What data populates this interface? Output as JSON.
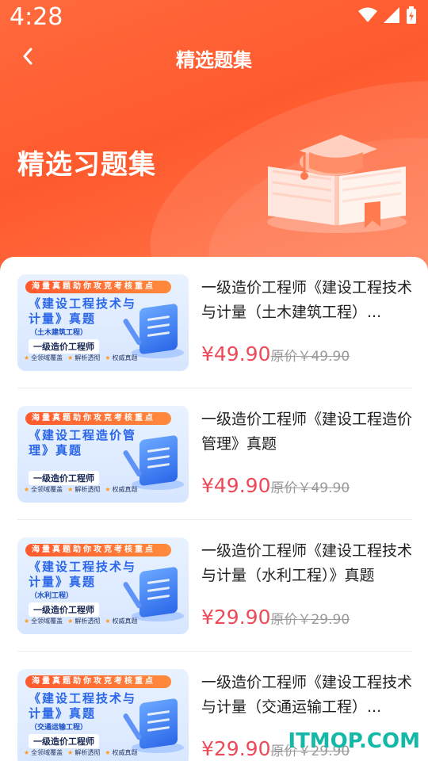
{
  "status_bar": {
    "time": "4:28"
  },
  "nav": {
    "title": "精选题集"
  },
  "hero": {
    "title": "精选习题集"
  },
  "thumb_common": {
    "banner": "海量真题助你攻克考核重点",
    "tag": "一级造价工程师",
    "features": [
      "全领域覆盖",
      "解析透彻",
      "权威真题"
    ]
  },
  "items": [
    {
      "thumb_title": "《建设工程技术与计量》真题",
      "thumb_sub": "（土木建筑工程）",
      "title": "一级造价工程师《建设工程技术与计量（土木建筑工程）...",
      "price": "¥49.90",
      "original_price": "原价￥49.90"
    },
    {
      "thumb_title": "《建设工程造价管理》真题",
      "thumb_sub": "",
      "title": "一级造价工程师《建设工程造价管理》真题",
      "price": "¥49.90",
      "original_price": "原价￥49.90"
    },
    {
      "thumb_title": "《建设工程技术与计量》真题",
      "thumb_sub": "（水利工程）",
      "title": "一级造价工程师《建设工程技术与计量（水利工程）》真题",
      "price": "¥29.90",
      "original_price": "原价￥29.90"
    },
    {
      "thumb_title": "《建设工程技术与计量》真题",
      "thumb_sub": "（交通运输工程）",
      "title": "一级造价工程师《建设工程技术与计量（交通运输工程）...",
      "price": "¥29.90",
      "original_price": "原价￥29.90"
    }
  ],
  "watermark": "ITMOP.COM",
  "colors": {
    "header": "#ff5a2e",
    "price": "#ec4a58",
    "thumb_title": "#2a66e8"
  }
}
